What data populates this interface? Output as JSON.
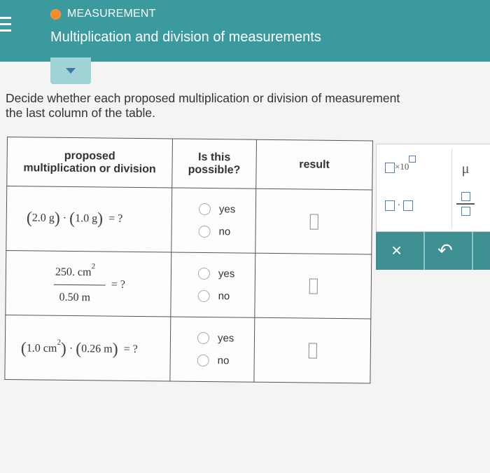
{
  "header": {
    "topic": "MEASUREMENT",
    "title": "Multiplication and division of measurements",
    "topic_color": "#f58a2a",
    "bg_color": "#3b9a9d"
  },
  "instructions": {
    "line1": "Decide whether each proposed multiplication or division of measurement",
    "line2": "the last column of the table."
  },
  "table": {
    "headers": {
      "col1_line1": "proposed",
      "col1_line2": "multiplication or division",
      "col2_line1": "Is this",
      "col2_line2": "possible?",
      "col3": "result"
    },
    "rows": [
      {
        "expr": {
          "a": "2.0",
          "a_unit": "g",
          "b": "1.0",
          "b_unit": "g",
          "tail": "= ?"
        },
        "yes": "yes",
        "no": "no"
      },
      {
        "expr": {
          "num": "250.",
          "num_unit": "cm",
          "num_exp": "2",
          "den": "0.50",
          "den_unit": "m",
          "tail": "= ?"
        },
        "yes": "yes",
        "no": "no"
      },
      {
        "expr": {
          "a": "1.0",
          "a_unit": "cm",
          "a_exp": "2",
          "b": "0.26",
          "b_unit": "m",
          "tail": "= ?"
        },
        "yes": "yes",
        "no": "no"
      }
    ]
  },
  "palette": {
    "sci_label": "×10",
    "mu": "μ",
    "dot": "·",
    "close": "×",
    "undo": "↶"
  }
}
